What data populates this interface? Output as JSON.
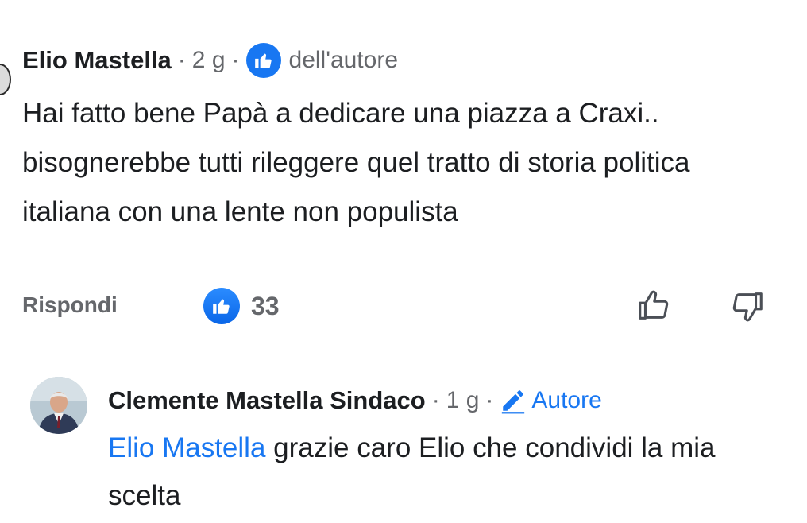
{
  "comment": {
    "author": "Elio Mastella",
    "time": "2 g",
    "separator": "·",
    "badge_icon": "thumbs-up-badge-icon",
    "badge_label": "dell'autore",
    "text": "Hai fatto bene Papà a dedicare una piazza a Craxi.. bisognerebbe tutti rileggere quel tratto di storia politica italiana con una lente non populista",
    "reply_label": "Rispondi",
    "like_count": "33",
    "like_icon": "thumbs-up-icon",
    "upvote_icon": "thumbs-up-outline-icon",
    "downvote_icon": "thumbs-down-outline-icon"
  },
  "reply": {
    "author": "Clemente Mastella Sindaco",
    "time": "1 g",
    "separator": "·",
    "role_icon": "pencil-icon",
    "role_label": "Autore",
    "mention": "Elio Mastella",
    "text": " grazie caro Elio che condividi la mia scelta"
  },
  "colors": {
    "accent": "#1877f2",
    "meta_text": "#65676b",
    "body_text": "#1c1e21"
  }
}
